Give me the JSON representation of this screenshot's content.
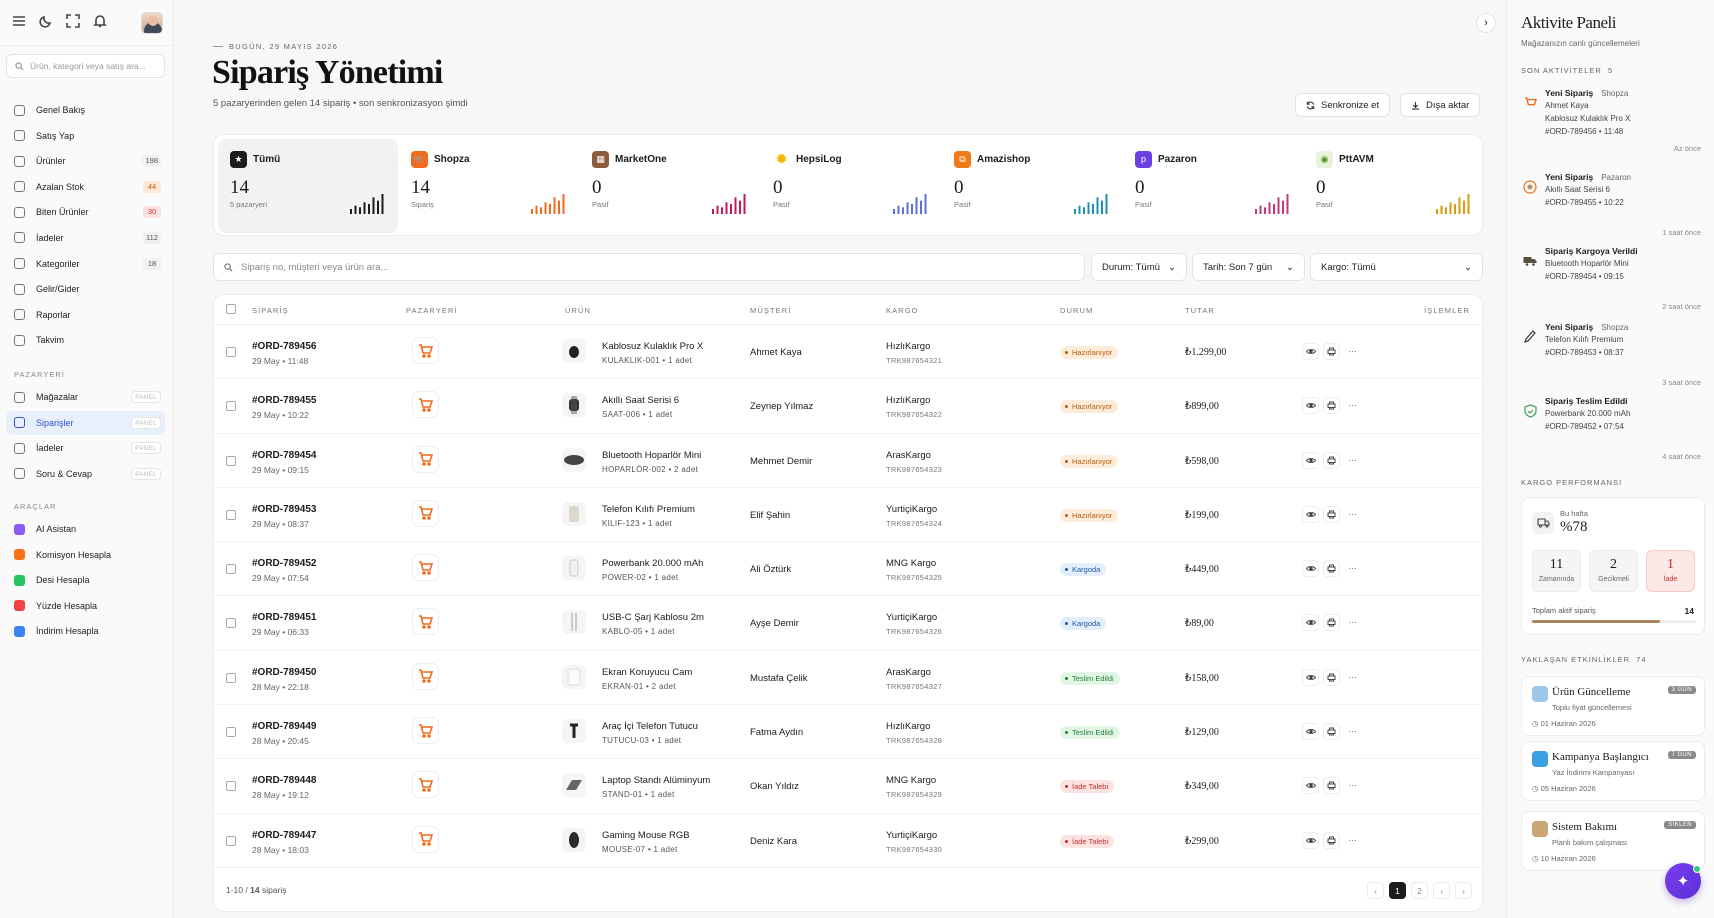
{
  "sidebar": {
    "search_placeholder": "Ürün, kategori veya satış ara...",
    "nav": [
      {
        "label": "Genel Bakış",
        "badge": ""
      },
      {
        "label": "Satış Yap",
        "badge": ""
      },
      {
        "label": "Ürünler",
        "badge": "198"
      },
      {
        "label": "Azalan Stok",
        "badge": "44"
      },
      {
        "label": "Biten Ürünler",
        "badge": "30"
      },
      {
        "label": "İadeler",
        "badge": "112"
      },
      {
        "label": "Kategoriler",
        "badge": "18"
      },
      {
        "label": "Gelir/Gider",
        "badge": ""
      },
      {
        "label": "Raporlar",
        "badge": ""
      },
      {
        "label": "Takvim",
        "badge": ""
      }
    ],
    "section_pazaryeri": "PAZARYERİ",
    "pazaryeri": [
      {
        "label": "Mağazalar",
        "badge": "PANEL"
      },
      {
        "label": "Siparişler",
        "badge": "PANEL"
      },
      {
        "label": "İadeler",
        "badge": "PANEL"
      },
      {
        "label": "Soru & Cevap",
        "badge": "PANEL"
      }
    ],
    "section_araclar": "ARAÇLAR",
    "tools": [
      {
        "label": "AI Asistan",
        "color": "#8b5cf6"
      },
      {
        "label": "Komisyon Hesapla",
        "color": "#f97316"
      },
      {
        "label": "Desi Hesapla",
        "color": "#22c55e"
      },
      {
        "label": "Yüzde Hesapla",
        "color": "#ef4444"
      },
      {
        "label": "İndirim Hesapla",
        "color": "#3b82f6"
      }
    ]
  },
  "header": {
    "date": "BUGÜN, 29 MAYIS 2026",
    "title": "Sipariş Yönetimi",
    "subtitle": "5 pazaryerinden gelen 14 sipariş • son senkronizasyon şimdi",
    "sync_label": "Senkronize et",
    "export_label": "Dışa aktar"
  },
  "marketplaces": [
    {
      "name": "Tümü",
      "count": "14",
      "caption": "5 pazaryeri",
      "color": "#1c1c1c",
      "bars": [
        3,
        5,
        4,
        7,
        6,
        10,
        8,
        12
      ]
    },
    {
      "name": "Shopza",
      "count": "14",
      "caption": "Sipariş",
      "color": "#f26a1b",
      "bars": [
        3,
        5,
        4,
        7,
        6,
        10,
        8,
        12
      ]
    },
    {
      "name": "MarketOne",
      "count": "0",
      "caption": "Pasif",
      "color": "#c2185b",
      "bars": [
        3,
        5,
        4,
        7,
        6,
        10,
        8,
        12
      ]
    },
    {
      "name": "HepsiLog",
      "count": "0",
      "caption": "Pasif",
      "color": "#5b6fd6",
      "bars": [
        3,
        5,
        4,
        7,
        6,
        10,
        8,
        12
      ]
    },
    {
      "name": "Amazishop",
      "count": "0",
      "caption": "Pasif",
      "color": "#1b8fb3",
      "bars": [
        3,
        5,
        4,
        7,
        6,
        10,
        8,
        12
      ]
    },
    {
      "name": "Pazaron",
      "count": "0",
      "caption": "Pasif",
      "color": "#c2387b",
      "bars": [
        3,
        5,
        4,
        7,
        6,
        10,
        8,
        12
      ]
    },
    {
      "name": "PttAVM",
      "count": "0",
      "caption": "Pasif",
      "color": "#d99a0e",
      "bars": [
        3,
        5,
        4,
        7,
        6,
        10,
        8,
        12
      ]
    }
  ],
  "filters": {
    "search_placeholder": "Sipariş no, müşteri veya ürün ara...",
    "status": "Durum: Tümü",
    "date": "Tarih: Son 7 gün",
    "cargo": "Kargo: Tümü"
  },
  "table": {
    "headers": [
      "SİPARİŞ",
      "PAZARYERİ",
      "ÜRÜN",
      "MÜŞTERİ",
      "KARGO",
      "DURUM",
      "TUTAR",
      "İŞLEMLER"
    ],
    "rows": [
      {
        "id": "#ORD-789456",
        "date": "29 May • 11:48",
        "product": "Kablosuz Kulaklık Pro X",
        "sku": "KULAKLIK-001  •  1 adet",
        "customer": "Ahmet Kaya",
        "carrier": "HızlıKargo",
        "tracking": "TRK987654321",
        "status": "Hazırlanıyor",
        "st": "h",
        "amount": "₺1.299,00"
      },
      {
        "id": "#ORD-789455",
        "date": "29 May • 10:22",
        "product": "Akıllı Saat Serisi 6",
        "sku": "SAAT-006  •  1 adet",
        "customer": "Zeynep Yılmaz",
        "carrier": "HızlıKargo",
        "tracking": "TRK987654322",
        "status": "Hazırlanıyor",
        "st": "h",
        "amount": "₺899,00"
      },
      {
        "id": "#ORD-789454",
        "date": "29 May • 09:15",
        "product": "Bluetooth Hoparlör Mini",
        "sku": "HOPARLÖR-002  •  2 adet",
        "customer": "Mehmet Demir",
        "carrier": "ArasKargo",
        "tracking": "TRK987654323",
        "status": "Hazırlanıyor",
        "st": "h",
        "amount": "₺598,00"
      },
      {
        "id": "#ORD-789453",
        "date": "29 May • 08:37",
        "product": "Telefon Kılıfı Premium",
        "sku": "KILIF-123  •  1 adet",
        "customer": "Elif Şahin",
        "carrier": "YurtiçiKargo",
        "tracking": "TRK987654324",
        "status": "Hazırlanıyor",
        "st": "h",
        "amount": "₺199,00"
      },
      {
        "id": "#ORD-789452",
        "date": "29 May • 07:54",
        "product": "Powerbank 20.000 mAh",
        "sku": "POWER-02  •  1 adet",
        "customer": "Ali Öztürk",
        "carrier": "MNG Kargo",
        "tracking": "TRK987654325",
        "status": "Kargoda",
        "st": "k",
        "amount": "₺449,00"
      },
      {
        "id": "#ORD-789451",
        "date": "29 May • 06:33",
        "product": "USB-C Şarj Kablosu 2m",
        "sku": "KABLO-05  •  1 adet",
        "customer": "Ayşe Demir",
        "carrier": "YurtiçiKargo",
        "tracking": "TRK987654326",
        "status": "Kargoda",
        "st": "k",
        "amount": "₺89,00"
      },
      {
        "id": "#ORD-789450",
        "date": "28 May • 22:18",
        "product": "Ekran Koruyucu Cam",
        "sku": "EKRAN-01  •  2 adet",
        "customer": "Mustafa Çelik",
        "carrier": "ArasKargo",
        "tracking": "TRK987654327",
        "status": "Teslim Edildi",
        "st": "t",
        "amount": "₺158,00"
      },
      {
        "id": "#ORD-789449",
        "date": "28 May • 20:45",
        "product": "Araç İçi Telefon Tutucu",
        "sku": "TUTUCU-03  •  1 adet",
        "customer": "Fatma Aydın",
        "carrier": "HızlıKargo",
        "tracking": "TRK987654328",
        "status": "Teslim Edildi",
        "st": "t",
        "amount": "₺129,00"
      },
      {
        "id": "#ORD-789448",
        "date": "28 May • 19:12",
        "product": "Laptop Standı Alüminyum",
        "sku": "STAND-01  •  1 adet",
        "customer": "Okan Yıldız",
        "carrier": "MNG Kargo",
        "tracking": "TRK987654329",
        "status": "İade Talebi",
        "st": "i",
        "amount": "₺349,00"
      },
      {
        "id": "#ORD-789447",
        "date": "28 May • 18:03",
        "product": "Gaming Mouse RGB",
        "sku": "MOUSE-07  •  1 adet",
        "customer": "Deniz Kara",
        "carrier": "YurtiçiKargo",
        "tracking": "TRK987654330",
        "status": "İade Talebi",
        "st": "i",
        "amount": "₺299,00"
      }
    ],
    "footer_range": "1-10 / ",
    "footer_total": "14",
    "footer_suffix": " sipariş",
    "pages": [
      "1",
      "2"
    ]
  },
  "panel": {
    "title": "Aktivite Paneli",
    "subtitle": "Mağazanızın canlı güncellemeleri",
    "recent_label": "SON AKTİVİTELER",
    "recent_count": "5",
    "activities": [
      {
        "title": "Yeni Sipariş",
        "tag": "Shopza",
        "lines": [
          "Ahmet Kaya",
          "Kablosuz Kulaklık Pro X",
          "#ORD-789456 • 11:48"
        ],
        "ago": "Az önce"
      },
      {
        "title": "Yeni Sipariş",
        "tag": "Pazaron",
        "lines": [
          "Akıllı Saat Serisi 6",
          "#ORD-789455 • 10:22"
        ],
        "ago": "1 saat önce"
      },
      {
        "title": "Sipariş Kargoya Verildi",
        "tag": "",
        "lines": [
          "Bluetooth Hoparlör Mini",
          "#ORD-789454 • 09:15"
        ],
        "ago": "2 saat önce"
      },
      {
        "title": "Yeni Sipariş",
        "tag": "Shopza",
        "lines": [
          "Telefon Kılıfı Premium",
          "#ORD-789453 • 08:37"
        ],
        "ago": "3 saat önce"
      },
      {
        "title": "Sipariş Teslim Edildi",
        "tag": "",
        "lines": [
          "Powerbank 20.000 mAh",
          "#ORD-789452 • 07:54"
        ],
        "ago": "4 saat önce"
      }
    ],
    "cargo_label": "KARGO PERFORMANSI",
    "cargo_week_label": "Bu hafta",
    "cargo_week_value": "%78",
    "cargo_boxes": [
      {
        "value": "11",
        "label": "Zamanında"
      },
      {
        "value": "2",
        "label": "Gecikmeli"
      },
      {
        "value": "1",
        "label": "İade"
      }
    ],
    "cargo_active_label": "Toplam aktif sipariş",
    "cargo_active_value": "14",
    "cargo_progress": 0.78,
    "events_label": "YAKLAŞAN ETKİNLİKLER",
    "events_count": "74",
    "events": [
      {
        "title": "Ürün Güncelleme",
        "sub": "Toplu fiyat güncellemesi",
        "date": "01  Haziran  2026",
        "badge": "3 GÜN",
        "color": "#9cc7e8"
      },
      {
        "title": "Kampanya Başlangıcı",
        "sub": "Yaz İndirimi Kampanyası",
        "date": "05  Haziran  2026",
        "badge": "7 GÜN",
        "color": "#3aa0e0"
      },
      {
        "title": "Sistem Bakımı",
        "sub": "Planlı bakım çalışması",
        "date": "10 Haziran 2026",
        "badge": "SİKLEN",
        "color": "#c9a675"
      }
    ]
  }
}
